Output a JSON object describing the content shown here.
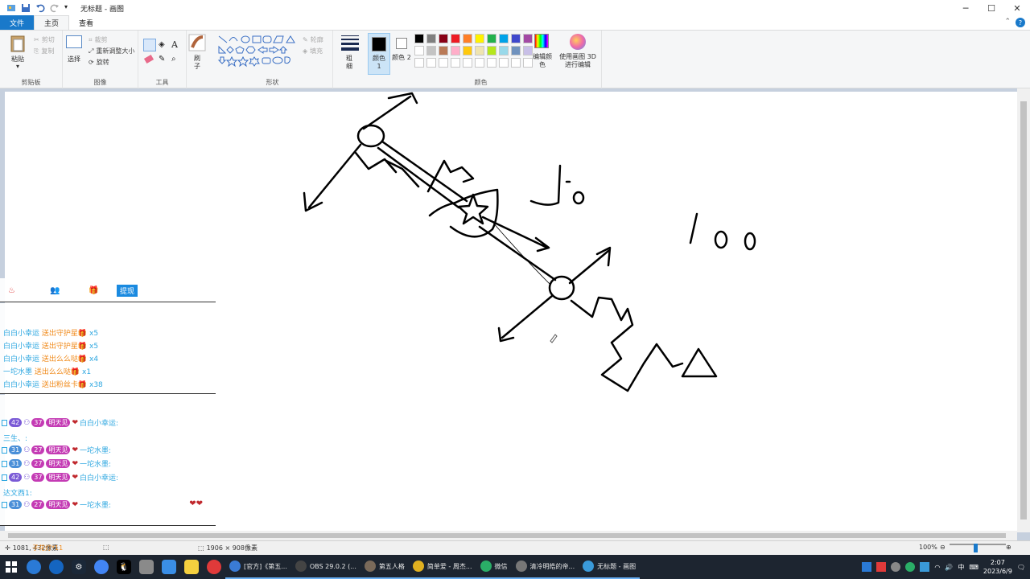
{
  "window": {
    "title": "无标题 - 画图",
    "minimize": "─",
    "maximize": "☐",
    "close": "✕"
  },
  "tabs": [
    "文件",
    "主页",
    "查看"
  ],
  "ribbon": {
    "clipboard": {
      "paste": "粘贴",
      "cut": "剪切",
      "copy": "复制",
      "group": "剪贴板"
    },
    "image": {
      "select": "选择",
      "crop": "裁剪",
      "resize": "重新调整大小",
      "rotate": "旋转",
      "group": "图像"
    },
    "tools": {
      "group": "工具",
      "text_icon": "A"
    },
    "brushes": {
      "label": "刷子"
    },
    "shapes": {
      "outline": "轮廓",
      "fill": "填充",
      "group": "形状"
    },
    "size": {
      "label": "粗细"
    },
    "color1": {
      "label": "颜色 1"
    },
    "color2": {
      "label": "颜色 2"
    },
    "colors_group": "颜色",
    "edit_colors": "编辑颜色",
    "paint3d": "使用画图 3D 进行编辑",
    "palette": [
      "#000000",
      "#7f7f7f",
      "#880015",
      "#ed1c24",
      "#ff7f27",
      "#fff200",
      "#22b14c",
      "#00a2e8",
      "#3f48cc",
      "#a349a4",
      "#ffffff",
      "#c3c3c3",
      "#b97a57",
      "#ffaec9",
      "#ffc90e",
      "#efe4b0",
      "#b5e61d",
      "#99d9ea",
      "#7092be",
      "#c8bfe7",
      "#ffffff",
      "#ffffff",
      "#ffffff",
      "#ffffff",
      "#ffffff",
      "#ffffff",
      "#ffffff",
      "#ffffff",
      "#ffffff",
      "#ffffff"
    ]
  },
  "overlay": {
    "top_tab": "提现",
    "gifts": [
      {
        "user": "白白小幸运",
        "action": "送出守护星",
        "count": "x5"
      },
      {
        "user": "白白小幸运",
        "action": "送出守护星",
        "count": "x5"
      },
      {
        "user": "白白小幸运",
        "action": "送出么么哒",
        "count": "x4"
      },
      {
        "user": "一坨水墨",
        "action": "送出么么哒",
        "count": "x1"
      },
      {
        "user": "白白小幸运",
        "action": "送出粉丝卡",
        "count": "x38"
      }
    ],
    "chat": [
      {
        "lv": "42",
        "fan_lv": "37",
        "fan": "明天见",
        "name": "白白小幸运:"
      },
      {
        "line": "三生、:"
      },
      {
        "lv": "31",
        "fan_lv": "27",
        "fan": "明天见",
        "name": "一坨水墨:"
      },
      {
        "lv": "31",
        "fan_lv": "27",
        "fan": "明天见",
        "name": "一坨水墨:"
      },
      {
        "lv": "42",
        "fan_lv": "37",
        "fan": "明天见",
        "name": "白白小幸运:"
      },
      {
        "line": "达文西1:"
      },
      {
        "lv": "31",
        "fan_lv": "27",
        "fan": "明天见",
        "name": "一坨水墨:"
      }
    ],
    "hearts": "❤❤",
    "bottom_text": "子花灯*11"
  },
  "canvas": {
    "note_a": "Jo",
    "note_b": "100"
  },
  "status": {
    "position": "1081, 432像素",
    "canvas_size": "1906 × 908像素",
    "zoom": "100%"
  },
  "taskbar": {
    "apps": [
      {
        "label": "[官方]《第五...",
        "color": "#3a7bd5"
      },
      {
        "label": "OBS 29.0.2 (...",
        "color": "#444444"
      },
      {
        "label": "第五人格",
        "color": "#7a6a5a"
      },
      {
        "label": "简单爱 - 周杰...",
        "color": "#e0b020"
      },
      {
        "label": "微信",
        "color": "#2aae67"
      },
      {
        "label": "清冷明皓的帝...",
        "color": "#777777"
      },
      {
        "label": "无标题 - 画图",
        "color": "#3a9ad9"
      }
    ],
    "ime": "中",
    "time": "2:07",
    "date": "2023/6/9"
  }
}
